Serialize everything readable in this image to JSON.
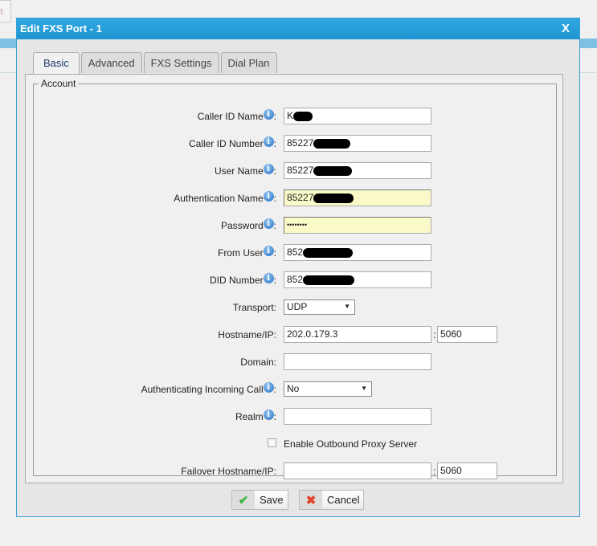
{
  "background": {
    "button_fragment": "rt"
  },
  "dialog": {
    "title": "Edit FXS Port - 1",
    "close_label": "X"
  },
  "tabs": [
    {
      "label": "Basic",
      "active": true
    },
    {
      "label": "Advanced"
    },
    {
      "label": "FXS Settings"
    },
    {
      "label": "Dial Plan"
    }
  ],
  "account": {
    "legend": "Account",
    "caller_id_name": {
      "label": "Caller ID Name",
      "value": "K"
    },
    "caller_id_number": {
      "label": "Caller ID Number",
      "value": "85227"
    },
    "user_name": {
      "label": "User Name",
      "value": "85227"
    },
    "auth_name": {
      "label": "Authentication Name",
      "value": "85227"
    },
    "password": {
      "label": "Password",
      "value": "••••••••"
    },
    "from_user": {
      "label": "From User",
      "value": "852"
    },
    "did_number": {
      "label": "DID Number",
      "value": "852"
    },
    "transport": {
      "label": "Transport",
      "value": "UDP"
    },
    "hostname": {
      "label": "Hostname/IP",
      "value": "202.0.179.3",
      "port": "5060"
    },
    "domain": {
      "label": "Domain",
      "value": ""
    },
    "auth_incoming": {
      "label": "Authenticating Incoming Call",
      "value": "No"
    },
    "realm": {
      "label": "Realm",
      "value": ""
    },
    "outbound_proxy": {
      "label": "Enable Outbound Proxy Server",
      "checked": false
    },
    "failover": {
      "label": "Failover Hostname/IP",
      "value": "",
      "port": "5060"
    }
  },
  "buttons": {
    "save": "Save",
    "cancel": "Cancel"
  },
  "colors": {
    "title_bar": "#1f94d2",
    "highlight_field": "#fafac8"
  }
}
